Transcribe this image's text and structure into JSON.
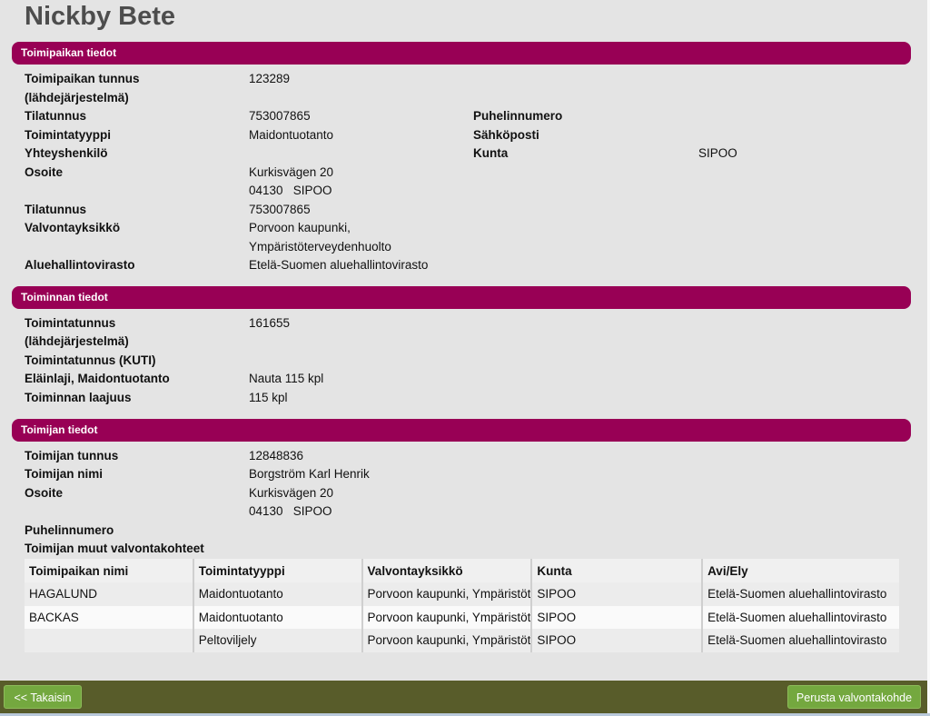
{
  "page": {
    "title": "Nickby Bete"
  },
  "sections": {
    "site": "Toimipaikan tiedot",
    "activity": "Toiminnan tiedot",
    "operator": "Toimijan tiedot"
  },
  "site": {
    "id_label_1": "Toimipaikan tunnus",
    "id_label_2": "(lähdejärjestelmä)",
    "id_value": "123289",
    "farm_label": "Tilatunnus",
    "farm_value": "753007865",
    "type_label": "Toimintatyyppi",
    "type_value": "Maidontuotanto",
    "contact_label": "Yhteyshenkilö",
    "address_label": "Osoite",
    "address_line1": "Kurkisvägen 20",
    "address_line2": "04130   SIPOO",
    "farm2_label": "Tilatunnus",
    "farm2_value": "753007865",
    "unit_label": "Valvontayksikkö",
    "unit_line1": "Porvoon kaupunki,",
    "unit_line2": "Ympäristöterveydenhuolto",
    "avi_label": "Aluehallintovirasto",
    "avi_value": "Etelä-Suomen aluehallintovirasto",
    "phone_label": "Puhelinnumero",
    "email_label": "Sähköposti",
    "municipality_label": "Kunta",
    "municipality_value": "SIPOO"
  },
  "activity": {
    "id_label_1": "Toimintatunnus",
    "id_label_2": "(lähdejärjestelmä)",
    "id_value": "161655",
    "kuti_label": "Toimintatunnus (KUTI)",
    "animal_label": "Eläinlaji, Maidontuotanto",
    "animal_value": "Nauta 115 kpl",
    "scope_label": "Toiminnan laajuus",
    "scope_value": "115 kpl"
  },
  "operator": {
    "id_label": "Toimijan tunnus",
    "id_value": "12848836",
    "name_label": "Toimijan nimi",
    "name_value": "Borgström Karl Henrik",
    "address_label": "Osoite",
    "address_line1": "Kurkisvägen 20",
    "address_line2": "04130   SIPOO",
    "phone_label": "Puhelinnumero",
    "others_label": "Toimijan muut valvontakohteet"
  },
  "table": {
    "headers": [
      "Toimipaikan nimi",
      "Toimintatyyppi",
      "Valvontayksikkö",
      "Kunta",
      "Avi/Ely"
    ],
    "rows": [
      [
        "HAGALUND",
        "Maidontuotanto",
        "Porvoon kaupunki, Ympäristöt",
        "SIPOO",
        "Etelä-Suomen aluehallintovirasto"
      ],
      [
        "BACKAS",
        "Maidontuotanto",
        "Porvoon kaupunki, Ympäristöt",
        "SIPOO",
        "Etelä-Suomen aluehallintovirasto"
      ],
      [
        "",
        "Peltoviljely",
        "Porvoon kaupunki, Ympäristöt",
        "SIPOO",
        "Etelä-Suomen aluehallintovirasto"
      ]
    ]
  },
  "footer": {
    "back_label": "<< Takaisin",
    "create_label": "Perusta valvontakohde"
  },
  "colors": {
    "section_bar": "#980055",
    "footer": "#585c2a",
    "button": "#74a83f"
  }
}
